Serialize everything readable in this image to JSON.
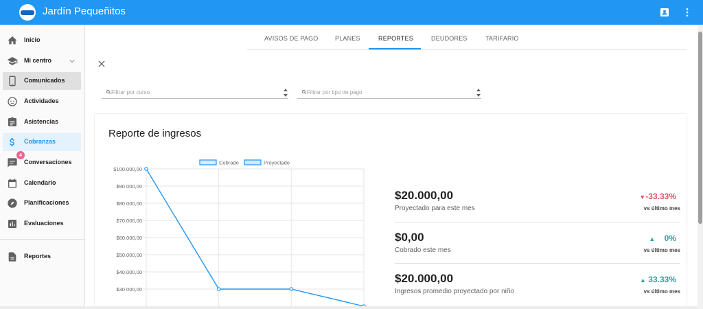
{
  "app": {
    "title": "Jardín Pequeñitos"
  },
  "sidebar": {
    "items": [
      {
        "label": "Inicio",
        "icon": "home-icon"
      },
      {
        "label": "Mi centro",
        "icon": "school-icon"
      },
      {
        "label": "Comunicados",
        "icon": "phone-icon"
      },
      {
        "label": "Actividades",
        "icon": "child-face-icon"
      },
      {
        "label": "Asistencias",
        "icon": "clipboard-icon"
      },
      {
        "label": "Cobranzas",
        "icon": "dollar-icon"
      },
      {
        "label": "Conversaciones",
        "icon": "chat-icon",
        "badge": "4"
      },
      {
        "label": "Calendario",
        "icon": "calendar-icon"
      },
      {
        "label": "Planificaciones",
        "icon": "compass-icon"
      },
      {
        "label": "Evaluaciones",
        "icon": "bar-chart-icon"
      },
      {
        "label": "Reportes",
        "icon": "document-icon"
      }
    ]
  },
  "tabs": [
    {
      "label": "AVISOS DE PAGO"
    },
    {
      "label": "PLANES"
    },
    {
      "label": "REPORTES",
      "active": true
    },
    {
      "label": "DEUDORES"
    },
    {
      "label": "TARIFARIO"
    }
  ],
  "filters": {
    "curso_placeholder": "Filtrar por curso",
    "tipo_pago_placeholder": "Filtrar por tipo de pago"
  },
  "report": {
    "title": "Reporte de ingresos",
    "stats": [
      {
        "value": "$20.000,00",
        "label": "Proyectado para este mes",
        "change": "-33.33%",
        "direction": "down",
        "vs": "vs último mes"
      },
      {
        "value": "$0,00",
        "label": "Cobrado este mes",
        "change": "0%",
        "direction": "up",
        "vs": "vs último mes"
      },
      {
        "value": "$20.000,00",
        "label": "Ingresos promedio proyectado por niño",
        "change": "33.33%",
        "direction": "up",
        "vs": "vs último mes"
      }
    ]
  },
  "colors": {
    "primary": "#2196f3",
    "down": "#e8506a",
    "up": "#26a69a",
    "badge": "#f06292"
  },
  "chart_data": {
    "type": "line",
    "series": [
      {
        "name": "Cobrado",
        "values": []
      },
      {
        "name": "Proyectado",
        "values": [
          100000,
          30000,
          30000,
          20000
        ]
      }
    ],
    "y_ticks": [
      "$100.000,00",
      "$90.000,00",
      "$80.000,00",
      "$70.000,00",
      "$60.000,00",
      "$50.000,00",
      "$40.000,00",
      "$30.000,00"
    ],
    "ylim": [
      20000,
      100000
    ],
    "grid": true,
    "legend": "top"
  }
}
